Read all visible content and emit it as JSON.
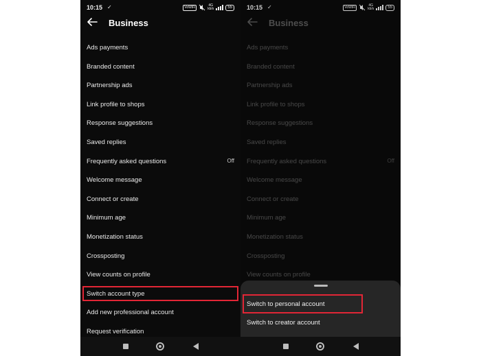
{
  "status": {
    "time": "10:15",
    "battery": "55"
  },
  "header": {
    "title": "Business"
  },
  "settings": [
    {
      "label": "Ads payments",
      "value": ""
    },
    {
      "label": "Branded content",
      "value": ""
    },
    {
      "label": "Partnership ads",
      "value": ""
    },
    {
      "label": "Link profile to shops",
      "value": ""
    },
    {
      "label": "Response suggestions",
      "value": ""
    },
    {
      "label": "Saved replies",
      "value": ""
    },
    {
      "label": "Frequently asked questions",
      "value": "Off"
    },
    {
      "label": "Welcome message",
      "value": ""
    },
    {
      "label": "Connect or create",
      "value": ""
    },
    {
      "label": "Minimum age",
      "value": ""
    },
    {
      "label": "Monetization status",
      "value": ""
    },
    {
      "label": "Crossposting",
      "value": ""
    },
    {
      "label": "View counts on profile",
      "value": ""
    },
    {
      "label": "Switch account type",
      "value": ""
    },
    {
      "label": "Add new professional account",
      "value": ""
    },
    {
      "label": "Request verification",
      "value": ""
    }
  ],
  "sheet": {
    "options": [
      "Switch to personal account",
      "Switch to creator account"
    ]
  },
  "colors": {
    "highlight": "#e32636",
    "background": "#0b0b0b",
    "sheet": "#262626"
  }
}
